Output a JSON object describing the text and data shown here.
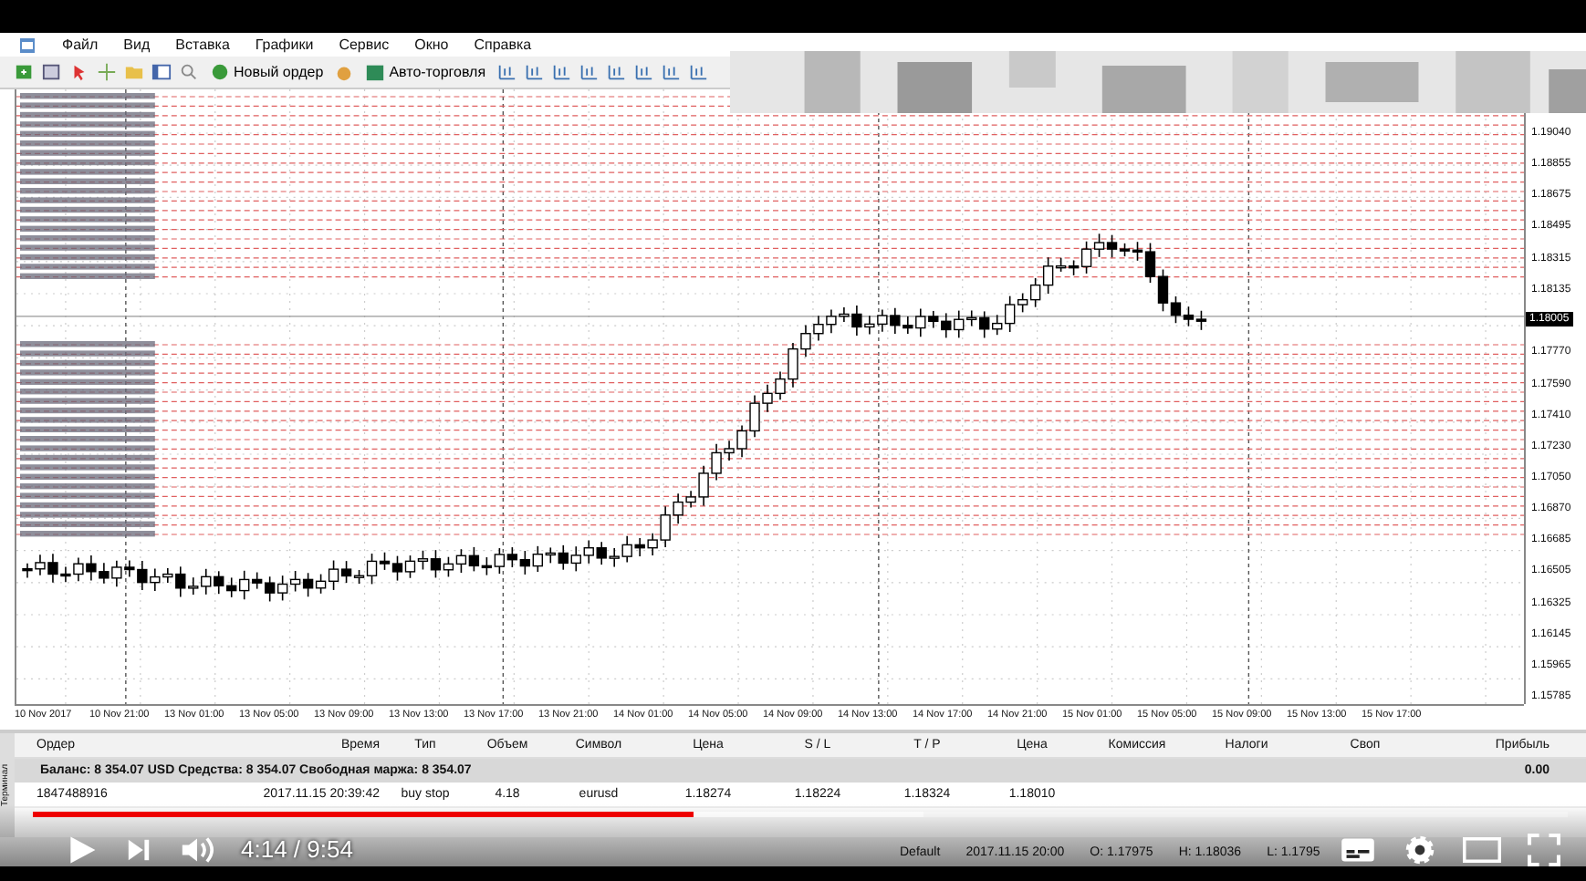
{
  "menu": [
    "Файл",
    "Вид",
    "Вставка",
    "Графики",
    "Сервис",
    "Окно",
    "Справка"
  ],
  "toolbar": {
    "buttons": [
      "Новый ордер",
      "Авто-торговля"
    ]
  },
  "chart": {
    "price_labels": [
      "1.19040",
      "1.18855",
      "1.18675",
      "1.18495",
      "1.18315",
      "1.18135",
      "1.17770",
      "1.17590",
      "1.17410",
      "1.17230",
      "1.17050",
      "1.16870",
      "1.16685",
      "1.16505",
      "1.16325",
      "1.16145",
      "1.15965",
      "1.15785"
    ],
    "current_price": "1.18005",
    "time_labels": [
      "10 Nov 2017",
      "10 Nov 21:00",
      "13 Nov 01:00",
      "13 Nov 05:00",
      "13 Nov 09:00",
      "13 Nov 13:00",
      "13 Nov 17:00",
      "13 Nov 21:00",
      "14 Nov 01:00",
      "14 Nov 05:00",
      "14 Nov 09:00",
      "14 Nov 13:00",
      "14 Nov 17:00",
      "14 Nov 21:00",
      "15 Nov 01:00",
      "15 Nov 05:00",
      "15 Nov 09:00",
      "15 Nov 13:00",
      "15 Nov 17:00"
    ]
  },
  "terminal": {
    "tab": "Терминал",
    "columns": [
      "Ордер",
      "Время",
      "Тип",
      "Объем",
      "Символ",
      "Цена",
      "S / L",
      "T / P",
      "Цена",
      "Комиссия",
      "Налоги",
      "Своп",
      "Прибыль"
    ],
    "balance": "Баланс: 8 354.07 USD  Средства: 8 354.07  Свободная маржа: 8 354.07",
    "profit_total": "0.00",
    "rows": [
      {
        "cells": [
          "1847488916",
          "2017.11.15 20:39:42",
          "buy stop",
          "4.18",
          "eurusd",
          "1.18274",
          "1.18224",
          "1.18324",
          "1.18010"
        ]
      }
    ]
  },
  "status_bar": [
    "Default",
    "2017.11.15 20:00",
    "O: 1.17975",
    "H: 1.18036",
    "L: 1.1795"
  ],
  "player": {
    "time": "4:14 / 9:54",
    "level": 0.43
  }
}
